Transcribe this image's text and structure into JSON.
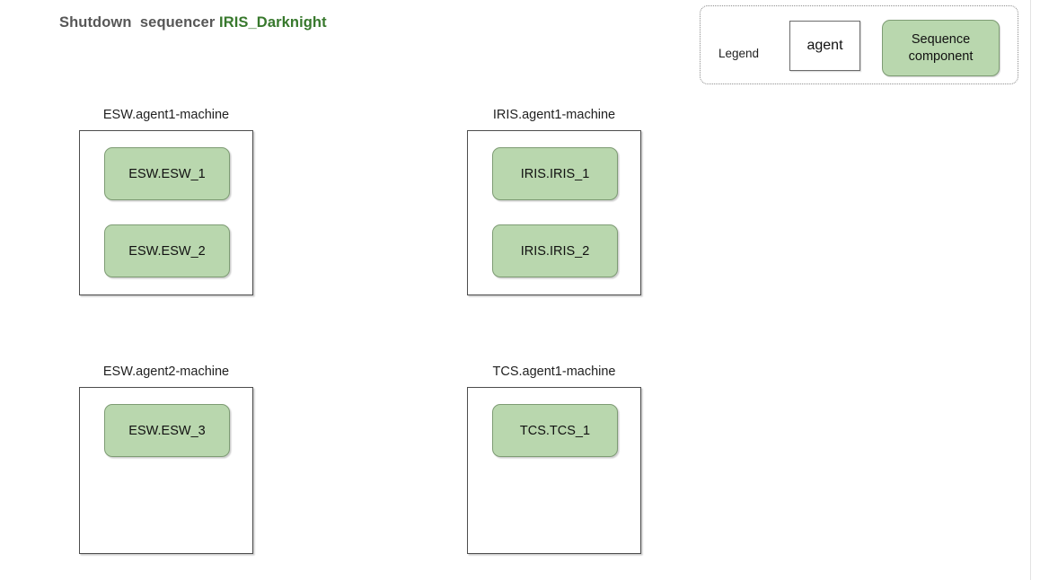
{
  "title": {
    "prefix": "Shutdown  sequencer ",
    "sequencer_name": "IRIS_Darknight",
    "accent_color": "#37782c",
    "text_color": "#575757"
  },
  "legend": {
    "label": "Legend",
    "agent_item": "agent",
    "component_item": "Sequence\ncomponent",
    "component_item_line1": "Sequence",
    "component_item_line2": "component",
    "agent_fill": "#ffffff",
    "agent_border": "#6b6b6b",
    "component_fill": "#b9d7ae",
    "component_border": "#7e9c74",
    "border_style": "dotted"
  },
  "machines": [
    {
      "label": "ESW.agent1-machine",
      "components": [
        {
          "label": "ESW.ESW_1"
        },
        {
          "label": "ESW.ESW_2"
        }
      ]
    },
    {
      "label": "IRIS.agent1-machine",
      "components": [
        {
          "label": "IRIS.IRIS_1"
        },
        {
          "label": "IRIS.IRIS_2"
        }
      ]
    },
    {
      "label": "ESW.agent2-machine",
      "components": [
        {
          "label": "ESW.ESW_3"
        }
      ]
    },
    {
      "label": "TCS.agent1-machine",
      "components": [
        {
          "label": "TCS.TCS_1"
        }
      ]
    }
  ]
}
